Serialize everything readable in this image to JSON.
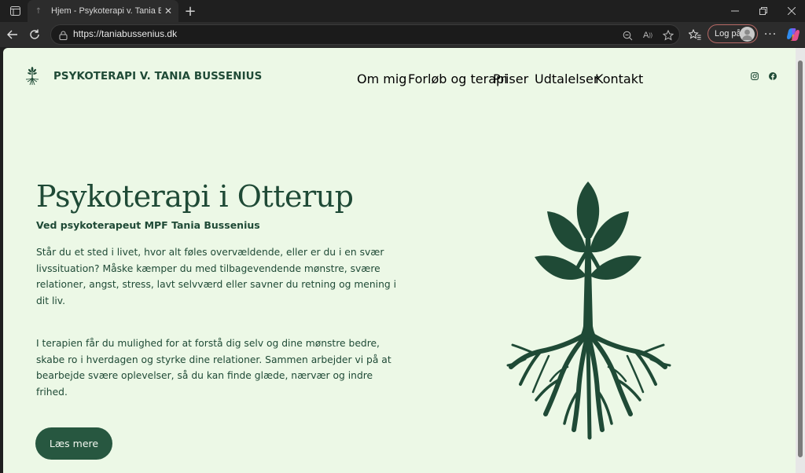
{
  "browser": {
    "tab_title": "Hjem - Psykoterapi v. Tania Bussenius",
    "url": "https://taniabussenius.dk",
    "login_label": "Log på"
  },
  "site": {
    "title": "PSYKOTERAPI V. TANIA BUSSENIUS",
    "nav": [
      {
        "label": "Om mig"
      },
      {
        "label": "Forløb og terapi"
      },
      {
        "label": "Priser"
      },
      {
        "label": "Udtalelser"
      },
      {
        "label": "Kontakt"
      }
    ],
    "social": [
      "instagram-icon",
      "facebook-icon"
    ]
  },
  "hero": {
    "heading": "Psykoterapi i Otterup",
    "subtitle": "Ved psykoterapeut MPF Tania Bussenius",
    "paragraph1": "Står du et sted i livet, hvor alt føles overvældende, eller er du i en svær livssituation? Måske kæmper du med tilbagevendende mønstre, svære relationer, angst, stress, lavt selvværd eller savner du retning og mening i dit liv.",
    "paragraph2": "I terapien får du mulighed for at forstå dig selv og dine mønstre bedre, skabe ro i hverdagen og styrke dine relationer. Sammen arbejder vi på at bearbejde svære oplevelser, så du kan finde glæde, nærvær og indre frihed.",
    "cta_label": "Læs mere"
  },
  "colors": {
    "background": "#ecf8e6",
    "primary": "#1f4a36",
    "button": "#275740"
  }
}
